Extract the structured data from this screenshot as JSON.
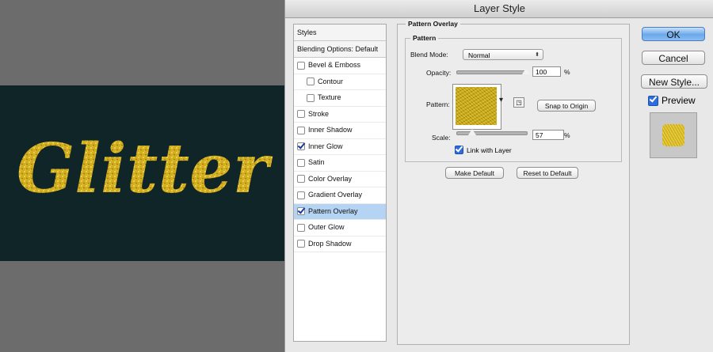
{
  "canvas": {
    "word": "Glitter",
    "band_color": "#0f2528",
    "text_color": "#d9b824"
  },
  "dialog": {
    "title": "Layer Style",
    "styles_list": {
      "header": "Styles",
      "blending": "Blending Options: Default",
      "items": [
        {
          "label": "Bevel & Emboss",
          "checked": false,
          "sub": false,
          "selected": false
        },
        {
          "label": "Contour",
          "checked": false,
          "sub": true,
          "selected": false
        },
        {
          "label": "Texture",
          "checked": false,
          "sub": true,
          "selected": false
        },
        {
          "label": "Stroke",
          "checked": false,
          "sub": false,
          "selected": false
        },
        {
          "label": "Inner Shadow",
          "checked": false,
          "sub": false,
          "selected": false
        },
        {
          "label": "Inner Glow",
          "checked": true,
          "sub": false,
          "selected": false
        },
        {
          "label": "Satin",
          "checked": false,
          "sub": false,
          "selected": false
        },
        {
          "label": "Color Overlay",
          "checked": false,
          "sub": false,
          "selected": false
        },
        {
          "label": "Gradient Overlay",
          "checked": false,
          "sub": false,
          "selected": false
        },
        {
          "label": "Pattern Overlay",
          "checked": true,
          "sub": false,
          "selected": true
        },
        {
          "label": "Outer Glow",
          "checked": false,
          "sub": false,
          "selected": false
        },
        {
          "label": "Drop Shadow",
          "checked": false,
          "sub": false,
          "selected": false
        }
      ]
    },
    "panel": {
      "section_title": "Pattern Overlay",
      "group_title": "Pattern",
      "blend_mode_label": "Blend Mode:",
      "blend_mode_value": "Normal",
      "opacity_label": "Opacity:",
      "opacity_value": "100",
      "opacity_unit": "%",
      "opacity_fraction": 1.0,
      "pattern_label": "Pattern:",
      "snap_button": "Snap to Origin",
      "scale_label": "Scale:",
      "scale_value": "57",
      "scale_unit": "%",
      "link_label": "Link with Layer",
      "link_checked": true,
      "make_default": "Make Default",
      "reset_default": "Reset to Default"
    },
    "buttons": {
      "ok": "OK",
      "cancel": "Cancel",
      "new_style": "New Style..."
    },
    "preview": {
      "label": "Preview",
      "checked": true
    }
  }
}
